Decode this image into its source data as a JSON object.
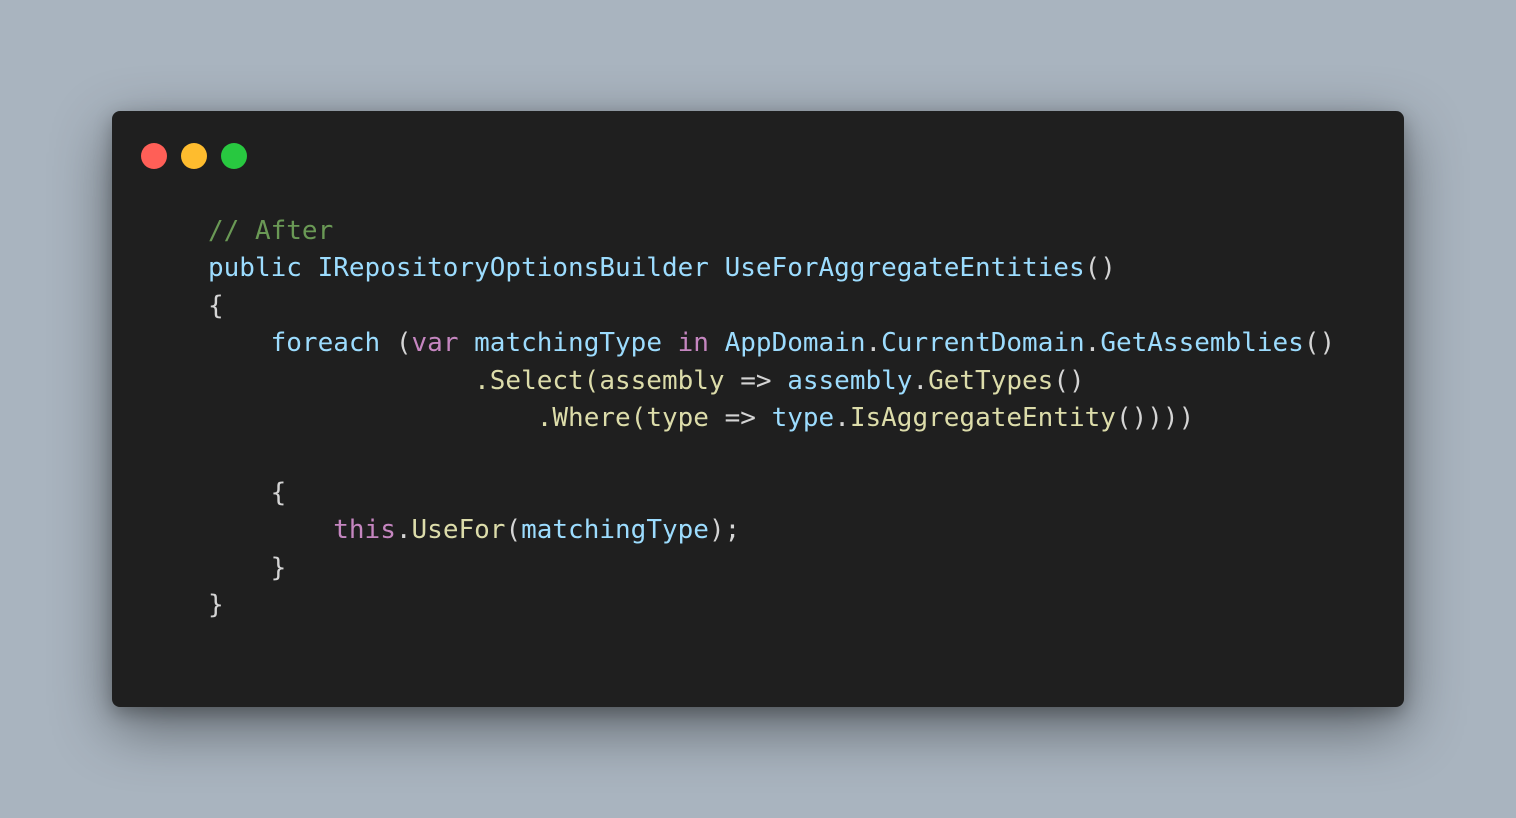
{
  "window": {
    "controls": {
      "close": "close",
      "minimize": "minimize",
      "maximize": "maximize"
    }
  },
  "code": {
    "lines": [
      [
        {
          "t": "// After",
          "c": "comment"
        }
      ],
      [
        {
          "t": "public",
          "c": "var"
        },
        {
          "t": " ",
          "c": "plain"
        },
        {
          "t": "IRepositoryOptionsBuilder",
          "c": "var"
        },
        {
          "t": " ",
          "c": "plain"
        },
        {
          "t": "UseForAggregateEntities",
          "c": "var"
        },
        {
          "t": "()",
          "c": "plain"
        }
      ],
      [
        {
          "t": "{",
          "c": "plain"
        }
      ],
      [
        {
          "t": "    ",
          "c": "plain"
        },
        {
          "t": "foreach",
          "c": "var"
        },
        {
          "t": " (",
          "c": "plain"
        },
        {
          "t": "var",
          "c": "control"
        },
        {
          "t": " ",
          "c": "plain"
        },
        {
          "t": "matchingType",
          "c": "var"
        },
        {
          "t": " ",
          "c": "plain"
        },
        {
          "t": "in",
          "c": "control"
        },
        {
          "t": " ",
          "c": "plain"
        },
        {
          "t": "AppDomain",
          "c": "var"
        },
        {
          "t": ".",
          "c": "plain"
        },
        {
          "t": "CurrentDomain",
          "c": "var"
        },
        {
          "t": ".",
          "c": "plain"
        },
        {
          "t": "GetAssemblies",
          "c": "var"
        },
        {
          "t": "()",
          "c": "plain"
        }
      ],
      [
        {
          "t": "                 ",
          "c": "plain"
        },
        {
          "t": ".Select(",
          "c": "method"
        },
        {
          "t": "assembly",
          "c": "method"
        },
        {
          "t": " => ",
          "c": "plain"
        },
        {
          "t": "assembly",
          "c": "var"
        },
        {
          "t": ".",
          "c": "plain"
        },
        {
          "t": "GetTypes",
          "c": "method"
        },
        {
          "t": "()",
          "c": "plain"
        }
      ],
      [
        {
          "t": "                     ",
          "c": "plain"
        },
        {
          "t": ".Where(",
          "c": "method"
        },
        {
          "t": "type",
          "c": "method"
        },
        {
          "t": " => ",
          "c": "plain"
        },
        {
          "t": "type",
          "c": "var"
        },
        {
          "t": ".",
          "c": "plain"
        },
        {
          "t": "IsAggregateEntity",
          "c": "method"
        },
        {
          "t": "())))",
          "c": "plain"
        }
      ],
      [],
      [
        {
          "t": "    {",
          "c": "plain"
        }
      ],
      [
        {
          "t": "        ",
          "c": "plain"
        },
        {
          "t": "this",
          "c": "control"
        },
        {
          "t": ".",
          "c": "plain"
        },
        {
          "t": "UseFor",
          "c": "method"
        },
        {
          "t": "(",
          "c": "plain"
        },
        {
          "t": "matchingType",
          "c": "var"
        },
        {
          "t": ");",
          "c": "plain"
        }
      ],
      [
        {
          "t": "    }",
          "c": "plain"
        }
      ],
      [
        {
          "t": "}",
          "c": "plain"
        }
      ]
    ]
  },
  "colors": {
    "comment": "#6a9955",
    "var": "#9cdcfe",
    "control": "#c586c0",
    "method": "#dcdcaa",
    "plain": "#d4d4d4",
    "background": "#1f1f1f",
    "page": "#a9b4bf"
  }
}
